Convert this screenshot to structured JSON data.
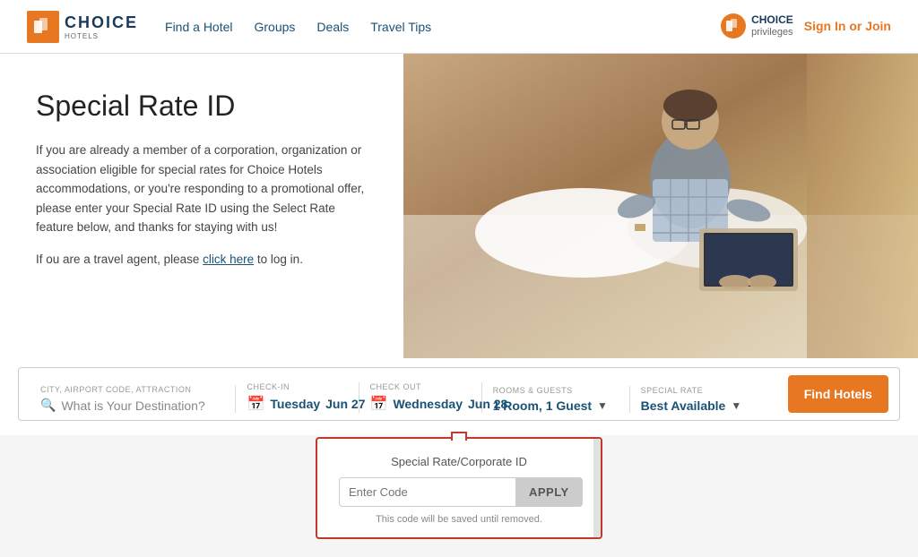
{
  "header": {
    "logo_text": "CHOICE",
    "logo_sub": "HOTELS",
    "logo_icon": "C",
    "nav": [
      {
        "label": "Find a Hotel",
        "id": "find-hotel"
      },
      {
        "label": "Groups",
        "id": "groups"
      },
      {
        "label": "Deals",
        "id": "deals"
      },
      {
        "label": "Travel Tips",
        "id": "travel-tips"
      }
    ],
    "cp_top": "CHOICE",
    "cp_bottom": "privileges",
    "sign_in": "Sign In or Join"
  },
  "hero": {
    "title": "Special Rate ID",
    "paragraph1": "If you are already a member of a corporation, organization or association eligible for special rates for Choice Hotels accommodations, or you're responding to a promotional offer, please enter your Special Rate ID using the Select Rate feature below, and thanks for staying with us!",
    "paragraph2_prefix": "If ou are a travel agent, please ",
    "paragraph2_link": "click here",
    "paragraph2_suffix": " to log in."
  },
  "search": {
    "destination_label": "CITY, AIRPORT CODE, ATTRACTION",
    "destination_placeholder": "What is Your Destination?",
    "checkin_label": "CHECK-IN",
    "checkin_day": "Tuesday",
    "checkin_date": "Jun 27",
    "checkout_label": "CHECK OUT",
    "checkout_day": "Wednesday",
    "checkout_date": "Jun 28",
    "rooms_label": "ROOMS & GUESTS",
    "rooms_value": "1 Room, 1 Guest",
    "rate_label": "SPECIAL RATE",
    "rate_value": "Best Available",
    "find_btn": "Find Hotels"
  },
  "dropdown": {
    "title": "Special Rate/Corporate ID",
    "input_placeholder": "Enter Code",
    "apply_btn": "APPLY",
    "hint": "This code will be saved until removed."
  }
}
